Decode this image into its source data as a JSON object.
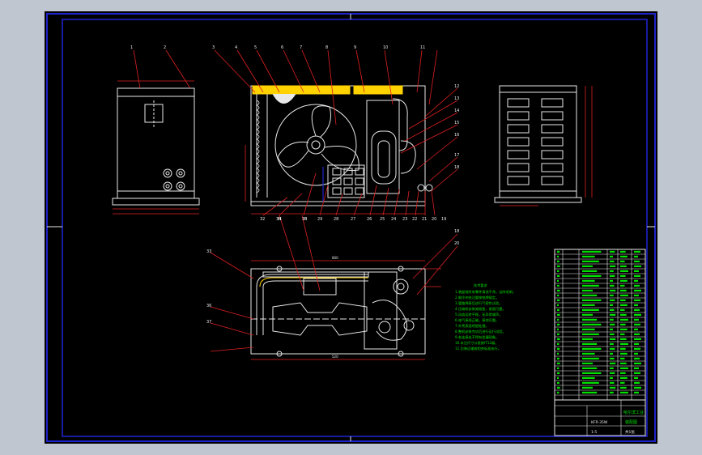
{
  "drawing": {
    "background": "#000000",
    "frame_color": "#1f24c8",
    "line_color": "#e8e8e8",
    "leader_color": "#e02020",
    "note_color": "#00e000",
    "accent_color": "#ffd200",
    "part_balloons_top": [
      "1",
      "2",
      "3",
      "4",
      "5",
      "6",
      "7",
      "8",
      "9",
      "10",
      "11"
    ],
    "part_balloons_right": [
      "12",
      "13",
      "14",
      "15",
      "16",
      "17",
      "18"
    ],
    "part_balloons_bottom": [
      "32",
      "31",
      "30",
      "29",
      "28",
      "27",
      "26",
      "25",
      "24",
      "23",
      "22",
      "21",
      "20",
      "19"
    ],
    "part_balloons_plan": [
      "33",
      "34",
      "35",
      "36",
      "37",
      "18",
      "20"
    ]
  },
  "notes": {
    "title": "技术要求",
    "lines": [
      "1.装配前所有零件清洗干净，去除毛刺。",
      "2.制冷剂充注量按铭牌规定。",
      "3.管路焊接后进行气密性试验。",
      "4.压缩机安装减振垫，紧固可靠。",
      "5.风扇运转平稳，无异常噪声。",
      "6.电气接线正确，接地可靠。",
      "7.外壳表面喷塑处理。",
      "8.整机安装完毕后进行运行试验。",
      "9.各连接处不得有泄漏现象。",
      "10.未注尺寸公差按IT12级。",
      "11.包装运输按相关标准执行。"
    ]
  },
  "title_block": {
    "school": "哈尔滨工业",
    "drawing_name": "装配图",
    "code": "KFR-35W",
    "scale": "1:5",
    "sheet": "共1张"
  }
}
